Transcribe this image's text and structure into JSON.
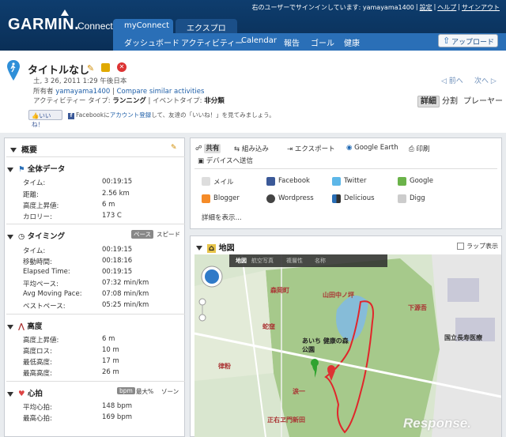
{
  "brand": {
    "logo": "GARMIN.",
    "sub": "Connect"
  },
  "user": {
    "signed_in": "右のユーザーでサインインしています: yamayama1400",
    "settings": "設定",
    "help": "ヘルプ",
    "signout": "サインアウト"
  },
  "tabs": {
    "my": "myConnect",
    "explore": "エクスプロー"
  },
  "subnav": [
    "ダッシュボード",
    "アクティビティー",
    "Calendar",
    "報告",
    "ゴール",
    "健康"
  ],
  "upload": "アップロード",
  "activity": {
    "title": "タイトルなし",
    "date": "土, 3 26, 2011 1:29 午後日本",
    "owner_label": "所有者",
    "owner": "yamayama1400",
    "compare": "Compare similar activities",
    "type_label": "アクティビティー タイプ:",
    "type": "ランニング",
    "event_label": "イベントタイプ:",
    "event": "非分類",
    "like": "いいね！",
    "fb_text_pre": "Facebookに",
    "fb_link": "アカウント登録",
    "fb_text_post": "して、友達の「いいね！」を見てみましょう。"
  },
  "pager": {
    "prev": "前へ",
    "next": "次へ"
  },
  "views": [
    "詳細",
    "分割",
    "プレーヤー"
  ],
  "summary": {
    "title": "概要",
    "overall": {
      "title": "全体データ",
      "rows": [
        {
          "label": "タイム:",
          "value": "00:19:15"
        },
        {
          "label": "距離:",
          "value": "2.56 km"
        },
        {
          "label": "高度上昇値:",
          "value": "6 m"
        },
        {
          "label": "カロリー:",
          "value": "173 C"
        }
      ]
    },
    "timing": {
      "title": "タイミング",
      "toggle_on": "ペース",
      "toggle_off": "スピード",
      "rows": [
        {
          "label": "タイム:",
          "value": "00:19:15"
        },
        {
          "label": "移動時間:",
          "value": "00:18:16"
        },
        {
          "label": "Elapsed Time:",
          "value": "00:19:15"
        },
        {
          "label": "平均ペース:",
          "value": "07:32 min/km"
        },
        {
          "label": "Avg Moving Pace:",
          "value": "07:08 min/km"
        },
        {
          "label": "ベストペース:",
          "value": "05:25 min/km"
        }
      ]
    },
    "elevation": {
      "title": "高度",
      "rows": [
        {
          "label": "高度上昇値:",
          "value": "6 m"
        },
        {
          "label": "高度ロス:",
          "value": "10 m"
        },
        {
          "label": "最低高度:",
          "value": "17 m"
        },
        {
          "label": "最高高度:",
          "value": "26 m"
        }
      ]
    },
    "heart": {
      "title": "心拍",
      "t1": "bpm",
      "t2": "最大%",
      "t3": "ゾーン",
      "rows": [
        {
          "label": "平均心拍:",
          "value": "148 bpm"
        },
        {
          "label": "最高心拍:",
          "value": "169 bpm"
        }
      ]
    }
  },
  "share": {
    "tabs": [
      "共有",
      "組み込み",
      "エクスポート",
      "Google Earth",
      "印刷",
      "デバイスへ送信"
    ],
    "items": [
      "メイル",
      "Facebook",
      "Twitter",
      "Google",
      "Blogger",
      "Wordpress",
      "Delicious",
      "Digg"
    ],
    "more": "詳細を表示..."
  },
  "map": {
    "title": "地図",
    "lap_label": "ラップ表示",
    "modes": [
      "地図",
      "航空写真",
      "複層性",
      "名称"
    ],
    "labels": [
      "森岡町",
      "山田中ノ坪",
      "蛇窪",
      "あいち 健康の森公園",
      "下源吾",
      "律粉",
      "涙一",
      "正右ヱ門新田",
      "国立長寿医療"
    ]
  },
  "watermark": "Response."
}
